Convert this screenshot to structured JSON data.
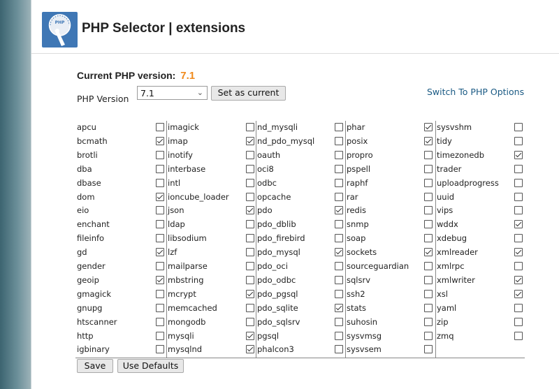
{
  "page": {
    "title": "PHP Selector | extensions"
  },
  "logo": {
    "text": "PHP"
  },
  "current_version": {
    "label": "Current PHP version:",
    "value": "7.1"
  },
  "version_select": {
    "label": "PHP Version",
    "selected": "7.1"
  },
  "buttons": {
    "set_current": "Set as current",
    "save": "Save",
    "use_defaults": "Use Defaults"
  },
  "switch_link": "Switch To PHP Options",
  "columns": [
    [
      {
        "name": "apcu",
        "checked": false
      },
      {
        "name": "bcmath",
        "checked": true
      },
      {
        "name": "brotli",
        "checked": false
      },
      {
        "name": "dba",
        "checked": false
      },
      {
        "name": "dbase",
        "checked": false
      },
      {
        "name": "dom",
        "checked": true
      },
      {
        "name": "eio",
        "checked": false
      },
      {
        "name": "enchant",
        "checked": false
      },
      {
        "name": "fileinfo",
        "checked": false
      },
      {
        "name": "gd",
        "checked": true
      },
      {
        "name": "gender",
        "checked": false
      },
      {
        "name": "geoip",
        "checked": true
      },
      {
        "name": "gmagick",
        "checked": false
      },
      {
        "name": "gnupg",
        "checked": false
      },
      {
        "name": "htscanner",
        "checked": false
      },
      {
        "name": "http",
        "checked": false
      },
      {
        "name": "igbinary",
        "checked": false
      }
    ],
    [
      {
        "name": "imagick",
        "checked": false
      },
      {
        "name": "imap",
        "checked": true
      },
      {
        "name": "inotify",
        "checked": false
      },
      {
        "name": "interbase",
        "checked": false
      },
      {
        "name": "intl",
        "checked": false
      },
      {
        "name": "ioncube_loader",
        "checked": false
      },
      {
        "name": "json",
        "checked": true
      },
      {
        "name": "ldap",
        "checked": false
      },
      {
        "name": "libsodium",
        "checked": false
      },
      {
        "name": "lzf",
        "checked": false
      },
      {
        "name": "mailparse",
        "checked": false
      },
      {
        "name": "mbstring",
        "checked": false
      },
      {
        "name": "mcrypt",
        "checked": true
      },
      {
        "name": "memcached",
        "checked": false
      },
      {
        "name": "mongodb",
        "checked": false
      },
      {
        "name": "mysqli",
        "checked": true
      },
      {
        "name": "mysqlnd",
        "checked": true
      }
    ],
    [
      {
        "name": "nd_mysqli",
        "checked": false
      },
      {
        "name": "nd_pdo_mysql",
        "checked": false
      },
      {
        "name": "oauth",
        "checked": false
      },
      {
        "name": "oci8",
        "checked": false
      },
      {
        "name": "odbc",
        "checked": false
      },
      {
        "name": "opcache",
        "checked": false
      },
      {
        "name": "pdo",
        "checked": true
      },
      {
        "name": "pdo_dblib",
        "checked": false
      },
      {
        "name": "pdo_firebird",
        "checked": false
      },
      {
        "name": "pdo_mysql",
        "checked": true
      },
      {
        "name": "pdo_oci",
        "checked": false
      },
      {
        "name": "pdo_odbc",
        "checked": false
      },
      {
        "name": "pdo_pgsql",
        "checked": false
      },
      {
        "name": "pdo_sqlite",
        "checked": true
      },
      {
        "name": "pdo_sqlsrv",
        "checked": false
      },
      {
        "name": "pgsql",
        "checked": false
      },
      {
        "name": "phalcon3",
        "checked": false
      }
    ],
    [
      {
        "name": "phar",
        "checked": true
      },
      {
        "name": "posix",
        "checked": true
      },
      {
        "name": "propro",
        "checked": false
      },
      {
        "name": "pspell",
        "checked": false
      },
      {
        "name": "raphf",
        "checked": false
      },
      {
        "name": "rar",
        "checked": false
      },
      {
        "name": "redis",
        "checked": false
      },
      {
        "name": "snmp",
        "checked": false
      },
      {
        "name": "soap",
        "checked": false
      },
      {
        "name": "sockets",
        "checked": true
      },
      {
        "name": "sourceguardian",
        "checked": false
      },
      {
        "name": "sqlsrv",
        "checked": false
      },
      {
        "name": "ssh2",
        "checked": false
      },
      {
        "name": "stats",
        "checked": false
      },
      {
        "name": "suhosin",
        "checked": false
      },
      {
        "name": "sysvmsg",
        "checked": false
      },
      {
        "name": "sysvsem",
        "checked": false
      }
    ],
    [
      {
        "name": "sysvshm",
        "checked": false
      },
      {
        "name": "tidy",
        "checked": false
      },
      {
        "name": "timezonedb",
        "checked": true
      },
      {
        "name": "trader",
        "checked": false
      },
      {
        "name": "uploadprogress",
        "checked": false
      },
      {
        "name": "uuid",
        "checked": false
      },
      {
        "name": "vips",
        "checked": false
      },
      {
        "name": "wddx",
        "checked": true
      },
      {
        "name": "xdebug",
        "checked": false
      },
      {
        "name": "xmlreader",
        "checked": true
      },
      {
        "name": "xmlrpc",
        "checked": false
      },
      {
        "name": "xmlwriter",
        "checked": true
      },
      {
        "name": "xsl",
        "checked": true
      },
      {
        "name": "yaml",
        "checked": false
      },
      {
        "name": "zip",
        "checked": false
      },
      {
        "name": "zmq",
        "checked": false
      }
    ]
  ]
}
